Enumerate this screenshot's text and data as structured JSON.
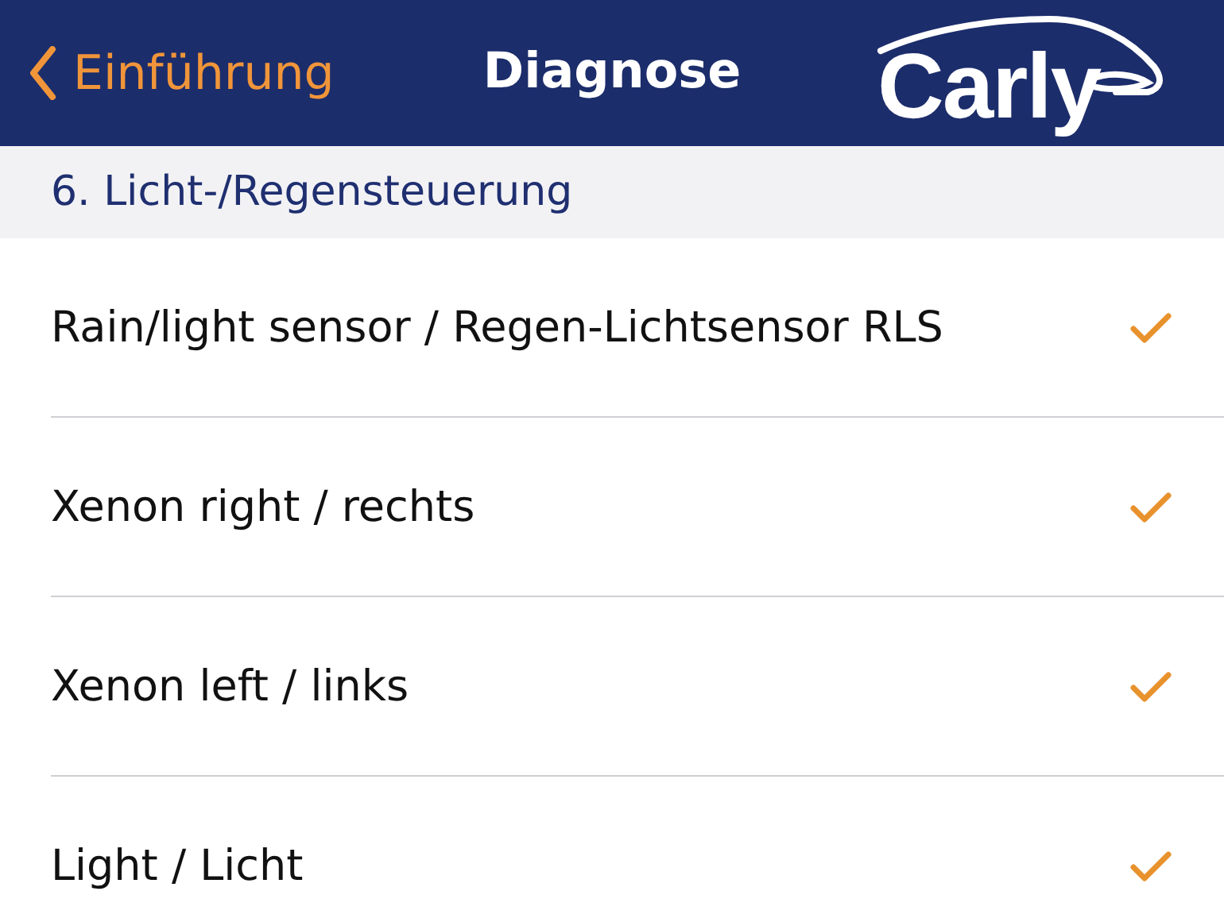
{
  "nav_bar": {
    "back_label": "Einführung",
    "title": "Diagnose",
    "logo": "Carly"
  },
  "section": {
    "title": "6. Licht-/Regensteuerung"
  },
  "items": [
    {
      "label": "Rain/light sensor / Regen-Lichtsensor RLS",
      "checked": true
    },
    {
      "label": "Xenon right / rechts",
      "checked": true
    },
    {
      "label": "Xenon left / links",
      "checked": true
    },
    {
      "label": "Light / Licht",
      "checked": true
    }
  ]
}
